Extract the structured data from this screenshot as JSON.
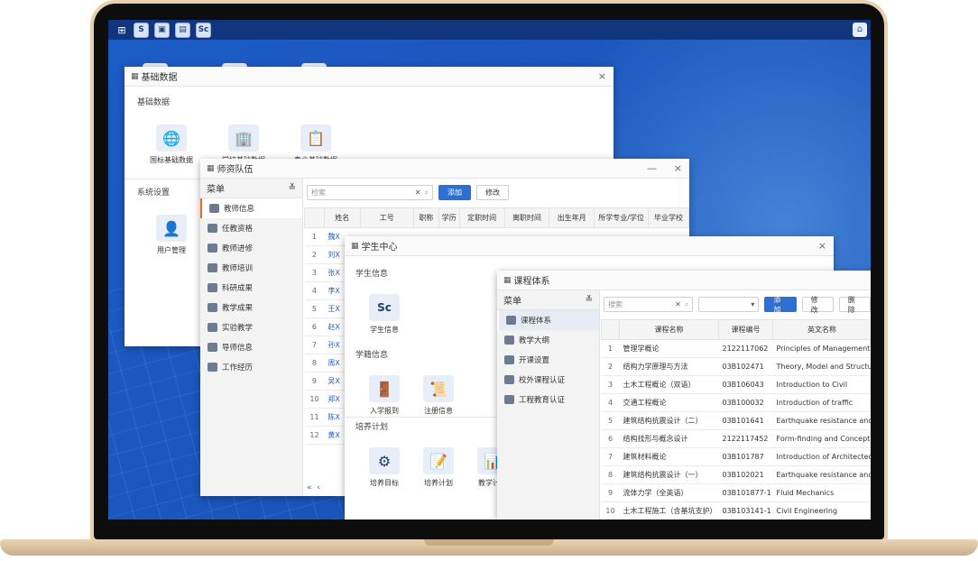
{
  "taskbar": {
    "apps": [
      "S",
      "▣",
      "▤",
      "Sc"
    ]
  },
  "win_basic": {
    "title": "基础数据",
    "section1": "基础数据",
    "tiles": [
      "国标基础数据",
      "学校基础数据",
      "专业基础数据"
    ],
    "section2": "系统设置",
    "tile_user": "用户管理"
  },
  "win_teachers": {
    "title": "师资队伍",
    "menu_title": "菜单",
    "menu": [
      "教师信息",
      "任教资格",
      "教师进修",
      "教师培训",
      "科研成果",
      "教学成果",
      "实验教学",
      "导师信息",
      "工作经历"
    ],
    "search_placeholder": "检索",
    "add": "添加",
    "edit": "修改",
    "columns": [
      "",
      "姓名",
      "工号",
      "职称",
      "学历",
      "定职时间",
      "离职时间",
      "出生年月",
      "所学专业/学位",
      "毕业学校"
    ],
    "rows": [
      [
        "1",
        "魏X"
      ],
      [
        "2",
        "刘X"
      ],
      [
        "3",
        "张X"
      ],
      [
        "4",
        "李X"
      ],
      [
        "5",
        "王X"
      ],
      [
        "6",
        "赵X"
      ],
      [
        "7",
        "孙X"
      ],
      [
        "8",
        "周X"
      ],
      [
        "9",
        "吴X"
      ],
      [
        "10",
        "郑X"
      ],
      [
        "11",
        "陈X"
      ],
      [
        "12",
        "黄X"
      ]
    ]
  },
  "win_students": {
    "title": "学生中心",
    "section1": "学生信息",
    "tile1": "学生信息",
    "section2": "学籍信息",
    "tiles2": [
      "入学报到",
      "注册信息"
    ],
    "section3": "培养计划",
    "tiles3": [
      "培养目标",
      "培养计划",
      "教学计划"
    ]
  },
  "win_courses": {
    "title": "课程体系",
    "menu_title": "菜单",
    "menu": [
      "课程体系",
      "教学大纲",
      "开课设置",
      "校外课程认证",
      "工程教育认证"
    ],
    "search_placeholder": "搜索",
    "add": "添加",
    "edit": "修改",
    "del": "删除",
    "columns": [
      "",
      "课程名称",
      "课程编号",
      "英文名称"
    ],
    "rows": [
      [
        "1",
        "管理学概论",
        "2122117062",
        "Principles of Management"
      ],
      [
        "2",
        "结构力学原理与方法",
        "03B102471",
        "Theory, Model and Structure"
      ],
      [
        "3",
        "土木工程概论（双语）",
        "03B106043",
        "Introduction to Civil"
      ],
      [
        "4",
        "交通工程概论",
        "03B100032",
        "Introduction of traffic"
      ],
      [
        "5",
        "建筑结构抗震设计（二）",
        "03B101641",
        "Earthquake resistance and"
      ],
      [
        "6",
        "结构找形与概念设计",
        "2122117452",
        "Form-finding and Concept"
      ],
      [
        "7",
        "建筑材料概论",
        "03B101787",
        "Introduction of Architected"
      ],
      [
        "8",
        "建筑结构抗震设计（一）",
        "03B102021",
        "Earthquake resistance and"
      ],
      [
        "9",
        "流体力学（全英语）",
        "03B101877-1",
        "Fluid Mechanics"
      ],
      [
        "10",
        "土木工程施工（含基坑支护）",
        "03B103141-1",
        "Civil Engineering"
      ]
    ]
  }
}
